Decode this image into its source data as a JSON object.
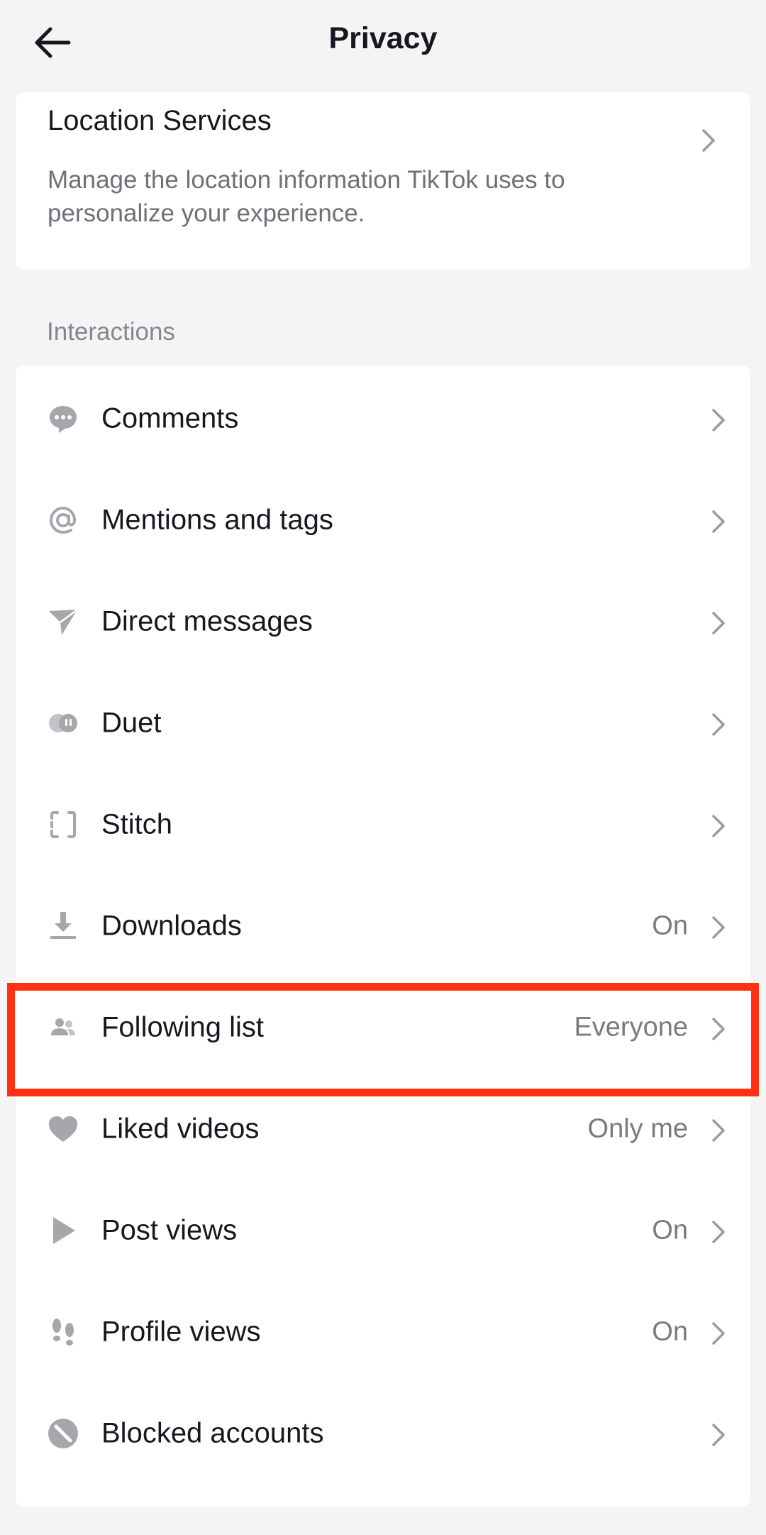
{
  "header": {
    "title": "Privacy",
    "back_icon": "arrow-left-icon"
  },
  "location_services": {
    "title": "Location Services",
    "description": "Manage the location information TikTok uses to personalize your experience."
  },
  "interactions": {
    "section_label": "Interactions",
    "items": [
      {
        "label": "Comments",
        "value": "",
        "icon": "comment-bubble-icon"
      },
      {
        "label": "Mentions and tags",
        "value": "",
        "icon": "at-sign-icon"
      },
      {
        "label": "Direct messages",
        "value": "",
        "icon": "paper-plane-icon"
      },
      {
        "label": "Duet",
        "value": "",
        "icon": "duet-icon"
      },
      {
        "label": "Stitch",
        "value": "",
        "icon": "stitch-icon"
      },
      {
        "label": "Downloads",
        "value": "On",
        "icon": "download-icon"
      },
      {
        "label": "Following list",
        "value": "Everyone",
        "icon": "people-icon"
      },
      {
        "label": "Liked videos",
        "value": "Only me",
        "icon": "heart-icon"
      },
      {
        "label": "Post views",
        "value": "On",
        "icon": "play-icon"
      },
      {
        "label": "Profile views",
        "value": "On",
        "icon": "footprints-icon"
      },
      {
        "label": "Blocked accounts",
        "value": "",
        "icon": "block-icon"
      }
    ]
  },
  "colors": {
    "background": "#f4f4f5",
    "card": "#ffffff",
    "icon_gray": "#a6a7ac",
    "highlight": "#ff3112"
  }
}
